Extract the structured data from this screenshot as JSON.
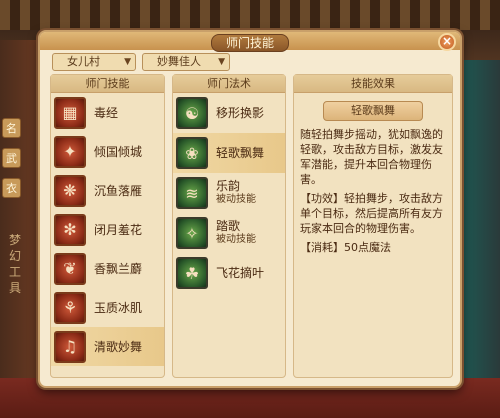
{
  "window": {
    "title": "师门技能",
    "close_label": "⊗"
  },
  "background": {
    "left_tags": [
      "名",
      "武",
      "衣"
    ],
    "left_text": "梦幻工具"
  },
  "filters": {
    "school": "女儿村",
    "title": "妙舞佳人"
  },
  "columns": {
    "skills_header": "师门技能",
    "spells_header": "师门法术",
    "effect_header": "技能效果"
  },
  "skills": [
    {
      "name": "毒经",
      "icon": "scroll-icon"
    },
    {
      "name": "倾国倾城",
      "icon": "dancer-icon"
    },
    {
      "name": "沉鱼落雁",
      "icon": "bird-icon"
    },
    {
      "name": "闭月羞花",
      "icon": "flower-icon"
    },
    {
      "name": "香飘兰麝",
      "icon": "orchid-icon"
    },
    {
      "name": "玉质冰肌",
      "icon": "jade-icon"
    },
    {
      "name": "清歌妙舞",
      "icon": "song-icon",
      "selected": true
    }
  ],
  "spells": [
    {
      "name": "移形换影",
      "sub": "",
      "icon": "shadow-icon"
    },
    {
      "name": "轻歌飘舞",
      "sub": "",
      "icon": "dance-icon",
      "selected": true
    },
    {
      "name": "乐韵",
      "sub": "被动技能",
      "icon": "music-icon"
    },
    {
      "name": "踏歌",
      "sub": "被动技能",
      "icon": "step-icon"
    },
    {
      "name": "飞花摘叶",
      "sub": "",
      "icon": "leaf-icon"
    }
  ],
  "effect": {
    "name": "轻歌飘舞",
    "description": "随轻拍舞步摇动，犹如飘逸的轻歌，攻击敌方目标，激发友军潜能，提升本回合物理伤害。",
    "effect": "【功效】轻拍舞步，攻击敌方单个目标，然后提高所有友方玩家本回合的物理伤害。",
    "cost": "【消耗】50点魔法"
  }
}
